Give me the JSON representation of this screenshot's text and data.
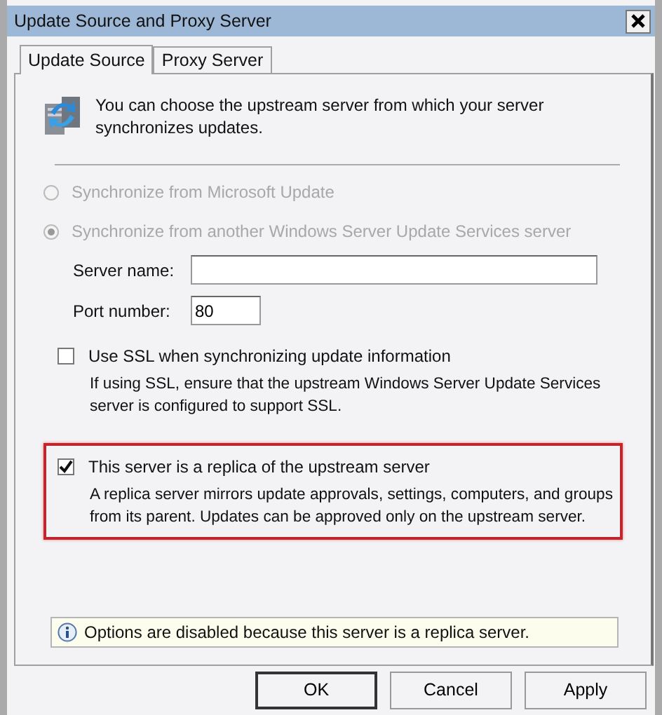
{
  "window": {
    "title": "Update Source and Proxy Server"
  },
  "tabs": [
    {
      "label": "Update Source",
      "selected": true
    },
    {
      "label": "Proxy Server",
      "selected": false
    }
  ],
  "intro": "You can choose the upstream server from which your server synchronizes updates.",
  "sources": [
    {
      "label": "Synchronize from Microsoft Update",
      "selected": false,
      "disabled": true
    },
    {
      "label": "Synchronize from another Windows Server Update Services server",
      "selected": true,
      "disabled": true
    }
  ],
  "fields": [
    {
      "label": "Server name:"
    },
    {
      "label": "Port number:",
      "value": "80"
    }
  ],
  "options": [
    {
      "label": "Use SSL when synchronizing update information",
      "description": "If using SSL, ensure that the upstream Windows Server Update Services server is configured to support SSL.",
      "checked": false,
      "highlighted": false
    },
    {
      "label": "This server is a replica of the upstream server",
      "description": "A replica server mirrors update approvals, settings, computers, and groups from its parent. Updates can be approved only on the upstream server.",
      "checked": true,
      "highlighted": true
    }
  ],
  "notice": "Options are disabled because this server is a replica server.",
  "buttons": [
    {
      "label": "OK",
      "default": true
    },
    {
      "label": "Cancel",
      "default": false
    },
    {
      "label": "Apply",
      "default": false
    }
  ]
}
